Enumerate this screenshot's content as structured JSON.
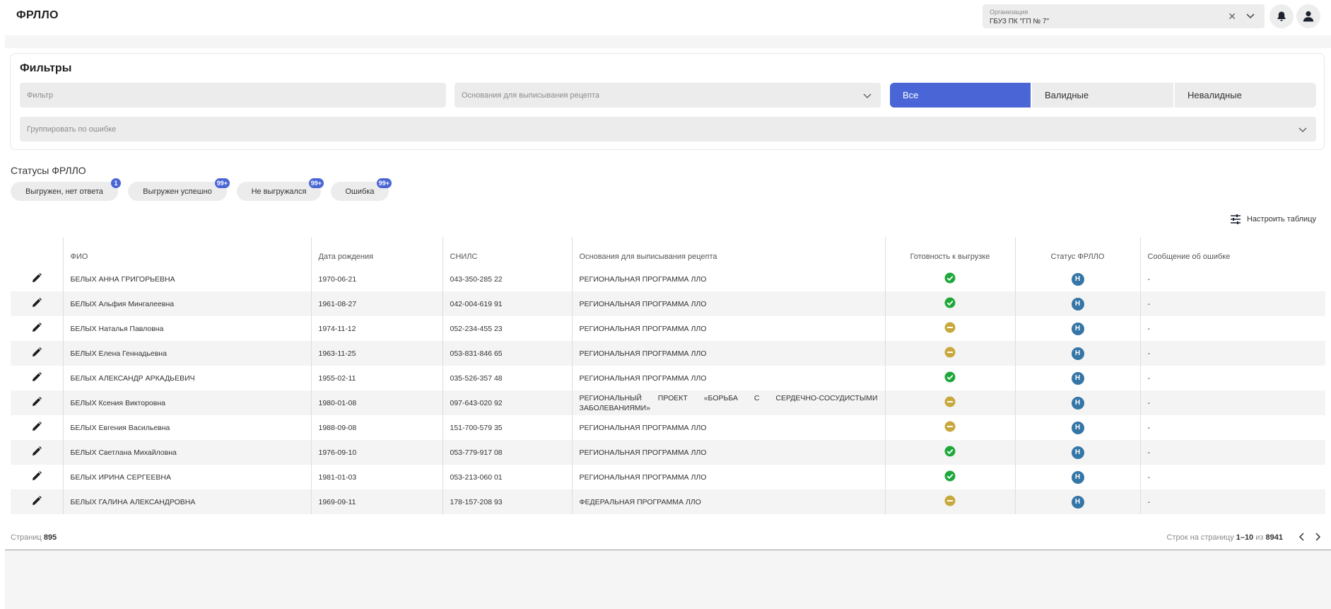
{
  "header": {
    "app_title": "ФРЛЛО",
    "org_label": "Организация",
    "org_value": "ГБУЗ ПК \"ГП № 7\""
  },
  "filters": {
    "title": "Фильтры",
    "filter_placeholder": "Фильтр",
    "basis_placeholder": "Основания для выписывания рецепта",
    "group_placeholder": "Группировать по ошибке",
    "segments": [
      "Все",
      "Валидные",
      "Невалидные"
    ]
  },
  "statuses": {
    "title": "Статусы ФРЛЛО",
    "chips": [
      {
        "label": "Выгружен, нет ответа",
        "count": "1"
      },
      {
        "label": "Выгружен успешно",
        "count": "99+"
      },
      {
        "label": "Не выгружался",
        "count": "99+"
      },
      {
        "label": "Ошибка",
        "count": "99+"
      }
    ]
  },
  "configure_label": "Настроить таблицу",
  "table": {
    "columns": [
      "ФИО",
      "Дата рождения",
      "СНИЛС",
      "Основания для выписывания рецепта",
      "Готовность к выгрузке",
      "Статус ФРЛЛО",
      "Сообщение об ошибке"
    ],
    "rows": [
      {
        "name": "БЕЛЫХ АННА ГРИГОРЬЕВНА",
        "birth": "1970-06-21",
        "snils": "043-350-285 22",
        "basis": "РЕГИОНАЛЬНАЯ ПРОГРАММА ЛЛО",
        "ready": "ok",
        "status": "Н",
        "error": "-"
      },
      {
        "name": "БЕЛЫХ Альфия Мингалеевна",
        "birth": "1961-08-27",
        "snils": "042-004-619 91",
        "basis": "РЕГИОНАЛЬНАЯ ПРОГРАММА ЛЛО",
        "ready": "ok",
        "status": "Н",
        "error": "-"
      },
      {
        "name": "БЕЛЫХ Наталья Павловна",
        "birth": "1974-11-12",
        "snils": "052-234-455 23",
        "basis": "РЕГИОНАЛЬНАЯ ПРОГРАММА ЛЛО",
        "ready": "pending",
        "status": "Н",
        "error": "-"
      },
      {
        "name": "БЕЛЫХ Елена Геннадьевна",
        "birth": "1963-11-25",
        "snils": "053-831-846 65",
        "basis": "РЕГИОНАЛЬНАЯ ПРОГРАММА ЛЛО",
        "ready": "pending",
        "status": "Н",
        "error": "-"
      },
      {
        "name": "БЕЛЫХ АЛЕКСАНДР АРКАДЬЕВИЧ",
        "birth": "1955-02-11",
        "snils": "035-526-357 48",
        "basis": "РЕГИОНАЛЬНАЯ ПРОГРАММА ЛЛО",
        "ready": "ok",
        "status": "Н",
        "error": "-"
      },
      {
        "name": "БЕЛЫХ Ксения Викторовна",
        "birth": "1980-01-08",
        "snils": "097-643-020 92",
        "basis": "РЕГИОНАЛЬНЫЙ ПРОЕКТ «БОРЬБА С СЕРДЕЧНО-СОСУДИСТЫМИ ЗАБОЛЕВАНИЯМИ»",
        "ready": "pending",
        "status": "Н",
        "error": "-"
      },
      {
        "name": "БЕЛЫХ Евгения Васильевна",
        "birth": "1988-09-08",
        "snils": "151-700-579 35",
        "basis": "РЕГИОНАЛЬНАЯ ПРОГРАММА ЛЛО",
        "ready": "pending",
        "status": "Н",
        "error": "-"
      },
      {
        "name": "БЕЛЫХ Светлана Михайловна",
        "birth": "1976-09-10",
        "snils": "053-779-917 08",
        "basis": "РЕГИОНАЛЬНАЯ ПРОГРАММА ЛЛО",
        "ready": "ok",
        "status": "Н",
        "error": "-"
      },
      {
        "name": "БЕЛЫХ ИРИНА СЕРГЕЕВНА",
        "birth": "1981-01-03",
        "snils": "053-213-060 01",
        "basis": "РЕГИОНАЛЬНАЯ ПРОГРАММА ЛЛО",
        "ready": "ok",
        "status": "Н",
        "error": "-"
      },
      {
        "name": "БЕЛЫХ ГАЛИНА АЛЕКСАНДРОВНА",
        "birth": "1969-09-11",
        "snils": "178-157-208 93",
        "basis": "ФЕДЕРАЛЬНАЯ ПРОГРАММА ЛЛО",
        "ready": "pending",
        "status": "Н",
        "error": "-"
      }
    ]
  },
  "footer": {
    "pages_label": "Страниц",
    "pages_value": "895",
    "rows_label": "Строк на страницу",
    "rows_range": "1–10",
    "of_label": "из",
    "total": "8941"
  },
  "colors": {
    "accent": "#4a66d6",
    "ok": "#1fa83a",
    "pending": "#c8a83c",
    "status_badge": "#3576a6"
  }
}
